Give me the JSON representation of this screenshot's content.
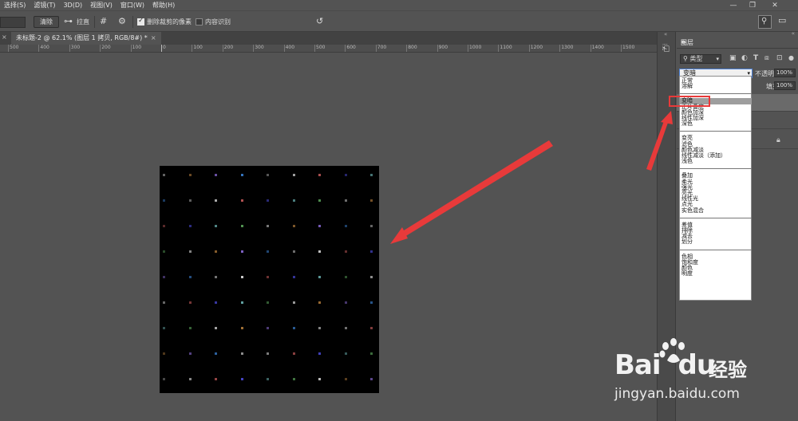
{
  "menubar": {
    "items": [
      "选择(S)",
      "滤镜(T)",
      "3D(D)",
      "视图(V)",
      "窗口(W)",
      "帮助(H)"
    ],
    "window_controls": [
      "—",
      "❐",
      "✕"
    ]
  },
  "options_bar": {
    "clear_button": "清除",
    "straighten_label": "拉直",
    "delete_cropped_label": "删除裁剪的像素",
    "delete_cropped_checked": true,
    "content_aware_label": "内容识别",
    "content_aware_checked": false
  },
  "document_tab": {
    "title": "未标题-2 @ 62.1% (图层 1 拷贝, RGB/8#) *",
    "close": "×"
  },
  "ruler": {
    "labels": [
      "500",
      "400",
      "300",
      "200",
      "100",
      "0",
      "100",
      "200",
      "300",
      "400",
      "500",
      "600",
      "700",
      "800",
      "900",
      "1000",
      "1100",
      "1200",
      "1300",
      "1400",
      "1500"
    ]
  },
  "layers_panel": {
    "title": "图层",
    "kind_label": "类型",
    "blend_mode_value": "变暗",
    "opacity_label": "不透明度:",
    "opacity_value": "100%",
    "fill_label": "填充:",
    "fill_value": "100%",
    "filter_icons": [
      "image-filter-icon",
      "adjustment-filter-icon",
      "text-filter-icon",
      "shape-filter-icon",
      "smart-object-filter-icon"
    ]
  },
  "blend_mode_dropdown": {
    "groups": [
      [
        "正常",
        "溶解"
      ],
      [
        "变暗",
        "正片叠底",
        "颜色加深",
        "线性加深",
        "深色"
      ],
      [
        "变亮",
        "滤色",
        "颜色减淡",
        "线性减淡（添加）",
        "浅色"
      ],
      [
        "叠加",
        "柔光",
        "强光",
        "亮光",
        "线性光",
        "点光",
        "实色混合"
      ],
      [
        "差值",
        "排除",
        "减去",
        "划分"
      ],
      [
        "色相",
        "饱和度",
        "颜色",
        "明度"
      ]
    ],
    "selected": "变暗"
  },
  "watermark": {
    "brand": "Bai",
    "brand_tail": "du",
    "cn": "经验",
    "url": "jingyan.baidu.com"
  },
  "colors": {
    "background": "#535353",
    "panel": "#535353",
    "highlight_red": "#e83a3a"
  }
}
